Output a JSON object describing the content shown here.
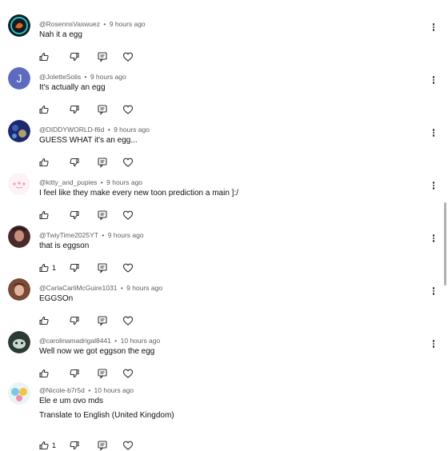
{
  "comments": [
    {
      "handle": "@RosennsVaswuez",
      "time": "9 hours ago",
      "text": "Nah it a egg",
      "avatar": "dark-circle-logo-icon",
      "likes": ""
    },
    {
      "handle": "@JoletteSolis",
      "time": "9 hours ago",
      "text": "It's actually an egg",
      "avatar": "letter-avatar",
      "avatar_letter": "J",
      "likes": ""
    },
    {
      "handle": "@DIDDYWORLD-f6d",
      "time": "9 hours ago",
      "text": "GUESS WHAT it's an egg...",
      "avatar": "starry-night-avatar",
      "likes": ""
    },
    {
      "handle": "@kitty_and_pupies",
      "time": "9 hours ago",
      "text": "I feel like they make every new toon prediction a main ]:/",
      "avatar": "cute-cat-avatar",
      "likes": ""
    },
    {
      "handle": "@TwiyTime2025YT",
      "time": "9 hours ago",
      "text": "that is eggson",
      "avatar": "photo-avatar",
      "likes": "1"
    },
    {
      "handle": "@CarlaCarliMcGuire1031",
      "time": "9 hours ago",
      "text": "EGGSOn",
      "avatar": "photo-avatar",
      "likes": ""
    },
    {
      "handle": "@carolinamadrigal8441",
      "time": "10 hours ago",
      "text": "Well now we got eggson the egg",
      "avatar": "character-avatar",
      "likes": ""
    },
    {
      "handle": "@Nicole-b7r5d",
      "time": "10 hours ago",
      "text": "Ele e um ovo mds",
      "avatar": "anime-avatar",
      "likes": "1"
    }
  ],
  "translate_label": "Translate to English (United Kingdom)",
  "colors": {
    "meta": "#606060",
    "text": "#0f0f0f",
    "letter_avatar_bg": "#5c6bc0"
  }
}
